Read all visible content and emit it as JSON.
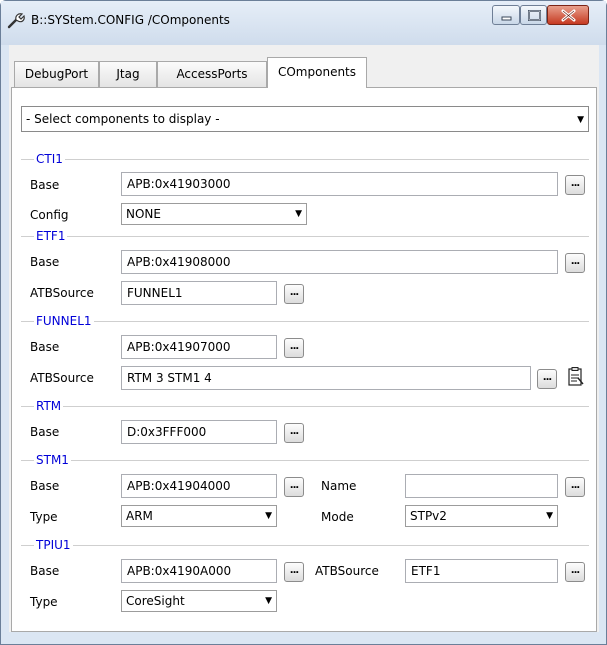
{
  "window": {
    "title": "B::SYStem.CONFIG /COmponents",
    "icon": "wrench-icon"
  },
  "tabs": [
    {
      "label": "DebugPort",
      "active": false
    },
    {
      "label": "Jtag",
      "active": false
    },
    {
      "label": "AccessPorts",
      "active": false
    },
    {
      "label": "COmponents",
      "active": true
    }
  ],
  "select_display": {
    "value": "- Select components to display -"
  },
  "groups": {
    "cti1": {
      "title": "CTI1",
      "base_label": "Base",
      "base_value": "APB:0x41903000",
      "config_label": "Config",
      "config_value": "NONE"
    },
    "etf1": {
      "title": "ETF1",
      "base_label": "Base",
      "base_value": "APB:0x41908000",
      "atb_label": "ATBSource",
      "atb_value": "FUNNEL1"
    },
    "funnel1": {
      "title": "FUNNEL1",
      "base_label": "Base",
      "base_value": "APB:0x41907000",
      "atb_label": "ATBSource",
      "atb_value": "RTM 3 STM1 4"
    },
    "rtm": {
      "title": "RTM",
      "base_label": "Base",
      "base_value": "D:0x3FFF000"
    },
    "stm1": {
      "title": "STM1",
      "base_label": "Base",
      "base_value": "APB:0x41904000",
      "name_label": "Name",
      "name_value": "",
      "type_label": "Type",
      "type_value": "ARM",
      "mode_label": "Mode",
      "mode_value": "STPv2"
    },
    "tpiu1": {
      "title": "TPIU1",
      "base_label": "Base",
      "base_value": "APB:0x4190A000",
      "atb_label": "ATBSource",
      "atb_value": "ETF1",
      "type_label": "Type",
      "type_value": "CoreSight"
    }
  },
  "browse_button_label": "...",
  "colors": {
    "group_title": "#0000d8",
    "window_frame": "#dbe6f3",
    "close_button": "#c63a22"
  }
}
